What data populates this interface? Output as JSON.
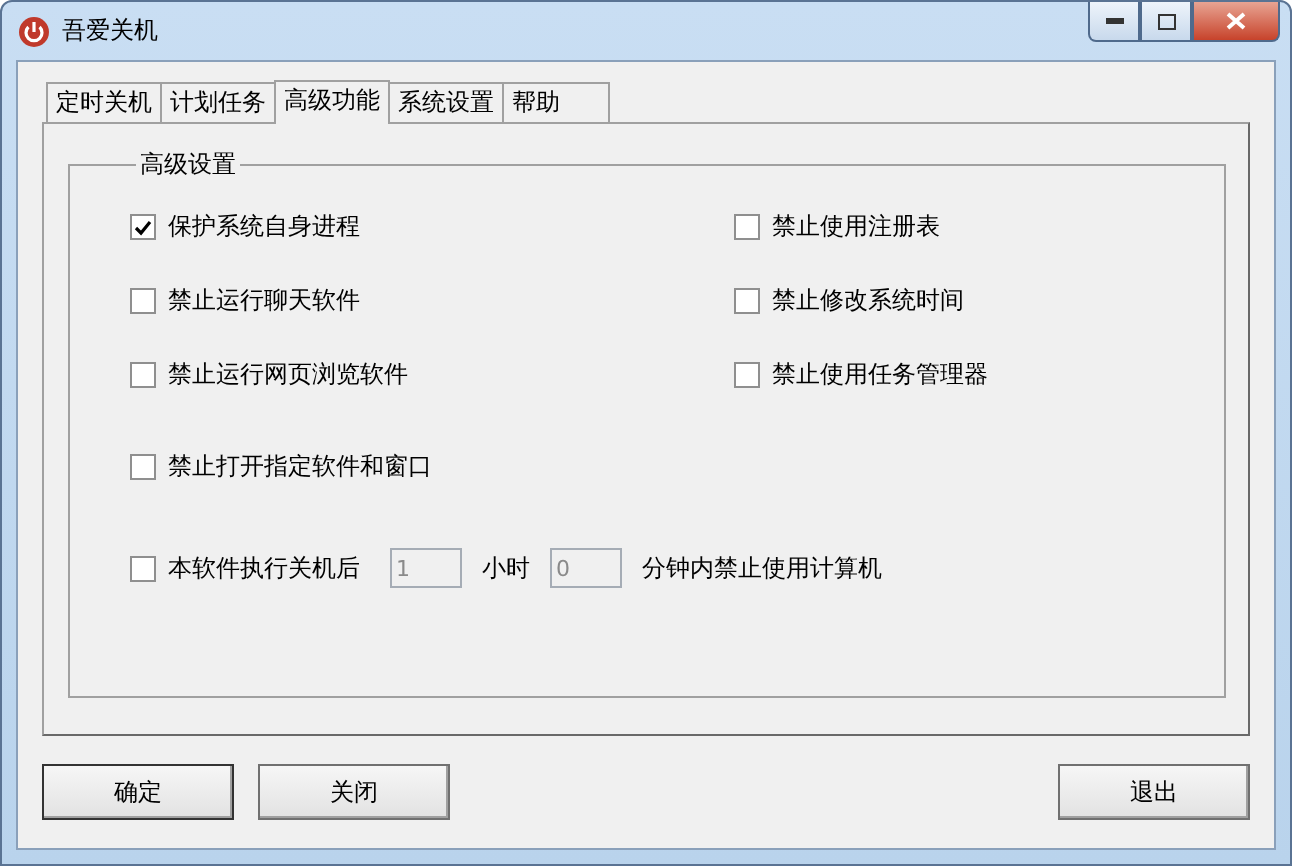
{
  "window": {
    "title": "吾爱关机"
  },
  "tabs": [
    {
      "label": "定时关机",
      "selected": false
    },
    {
      "label": "计划任务",
      "selected": false
    },
    {
      "label": "高级功能",
      "selected": true
    },
    {
      "label": "系统设置",
      "selected": false
    },
    {
      "label": "帮助",
      "selected": false
    }
  ],
  "group": {
    "title": "高级设置"
  },
  "options_left": [
    {
      "label": "保护系统自身进程",
      "checked": true
    },
    {
      "label": "禁止运行聊天软件",
      "checked": false
    },
    {
      "label": "禁止运行网页浏览软件",
      "checked": false
    }
  ],
  "options_right": [
    {
      "label": "禁止使用注册表",
      "checked": false
    },
    {
      "label": "禁止修改系统时间",
      "checked": false
    },
    {
      "label": "禁止使用任务管理器",
      "checked": false
    }
  ],
  "option_windows": {
    "label": "禁止打开指定软件和窗口",
    "checked": false
  },
  "timer": {
    "label": "本软件执行关机后",
    "checked": false,
    "hours": "1",
    "hours_unit": "小时",
    "minutes": "0",
    "suffix": "分钟内禁止使用计算机",
    "disabled": true
  },
  "buttons_left": [
    "确定",
    "关闭"
  ],
  "buttons_right": [
    "退出"
  ]
}
